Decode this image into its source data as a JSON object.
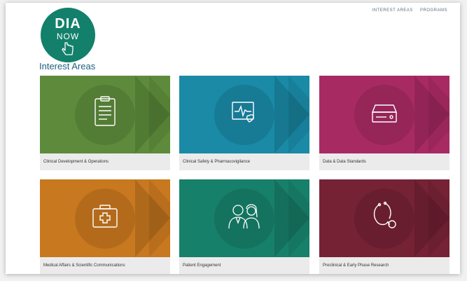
{
  "logo": {
    "line1": "DIA",
    "line2": "NOW"
  },
  "top_links": [
    "INTEREST AREAS",
    "PROGRAMS"
  ],
  "section_title": "Interest Areas",
  "tiles": [
    {
      "label": "Clinical Development & Operations",
      "color": "#5d8b3b",
      "icon": "clipboard-icon"
    },
    {
      "label": "Clinical Safety & Pharmacovigilance",
      "color": "#1a8aa6",
      "icon": "heart-monitor-icon"
    },
    {
      "label": "Data & Data Standards",
      "color": "#a82a63",
      "icon": "server-icon"
    },
    {
      "label": "Medical Affairs & Scientific Communications",
      "color": "#c8781f",
      "icon": "medical-kit-icon"
    },
    {
      "label": "Patient Engagement",
      "color": "#17806a",
      "icon": "doctors-icon"
    },
    {
      "label": "Preclinical & Early Phase Research",
      "color": "#752235",
      "icon": "stethoscope-icon"
    }
  ]
}
